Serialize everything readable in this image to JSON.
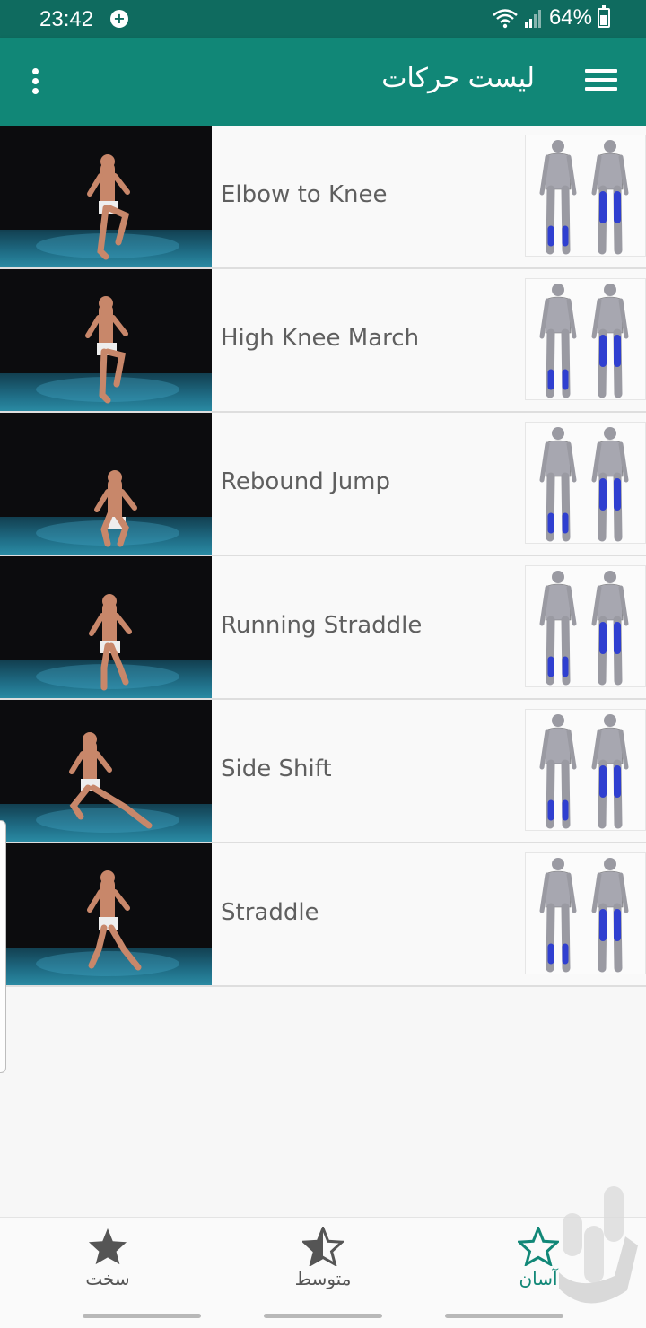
{
  "status_bar": {
    "time": "23:42",
    "battery": "64%",
    "notification_icon": "plus-badge-icon",
    "wifi_icon": "wifi-icon",
    "signal_icon": "signal-icon",
    "battery_icon": "battery-charging-icon"
  },
  "app_bar": {
    "title": "لیست حرکات",
    "menu_icon": "hamburger-menu-icon",
    "overflow_icon": "more-vertical-icon",
    "color": "#118777"
  },
  "exercises": [
    {
      "name": "Elbow to Knee",
      "thumbnail": "exercise-video-thumbnail",
      "muscle_diagram": "muscle-map-icon"
    },
    {
      "name": "High Knee March",
      "thumbnail": "exercise-video-thumbnail",
      "muscle_diagram": "muscle-map-icon"
    },
    {
      "name": "Rebound Jump",
      "thumbnail": "exercise-video-thumbnail",
      "muscle_diagram": "muscle-map-icon"
    },
    {
      "name": "Running Straddle",
      "thumbnail": "exercise-video-thumbnail",
      "muscle_diagram": "muscle-map-icon"
    },
    {
      "name": "Side Shift",
      "thumbnail": "exercise-video-thumbnail",
      "muscle_diagram": "muscle-map-icon"
    },
    {
      "name": "Straddle",
      "thumbnail": "exercise-video-thumbnail",
      "muscle_diagram": "muscle-map-icon"
    }
  ],
  "bottom_nav": {
    "items": [
      {
        "label": "سخت",
        "icon": "star-filled-icon",
        "active": false
      },
      {
        "label": "متوسط",
        "icon": "star-half-icon",
        "active": false
      },
      {
        "label": "آسان",
        "icon": "star-outline-icon",
        "active": true
      }
    ]
  },
  "colors": {
    "primary": "#118777",
    "status_bar": "#0f6b5f",
    "highlight_muscle": "#2f3fd0"
  }
}
